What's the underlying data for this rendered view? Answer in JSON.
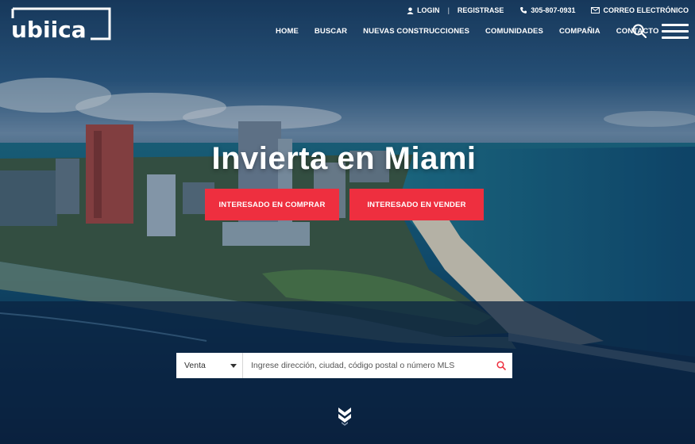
{
  "brand": {
    "logo_text": "ubiica"
  },
  "topbar": {
    "login_label": "LOGIN",
    "register_label": "REGISTRASE",
    "phone": "305-807-0931",
    "email_label": "CORREO ELECTRÓNICO"
  },
  "nav": {
    "items": [
      {
        "label": "HOME"
      },
      {
        "label": "BUSCAR"
      },
      {
        "label": "NUEVAS CONSTRUCCIONES"
      },
      {
        "label": "COMUNIDADES"
      },
      {
        "label": "COMPAÑIA"
      },
      {
        "label": "CONTACTO"
      }
    ]
  },
  "hero": {
    "title": "Invierta en Miami",
    "buy_label": "INTERESADO EN COMPRAR",
    "sell_label": "INTERESADO EN VENDER"
  },
  "search": {
    "type_selected": "Venta",
    "placeholder": "Ingrese dirección, ciudad, código postal o número MLS"
  },
  "colors": {
    "accent": "#ee2f3f",
    "text_light": "#ffffff"
  },
  "icons": [
    "user-icon",
    "phone-icon",
    "envelope-icon",
    "search-icon",
    "hamburger-menu-icon",
    "chevron-double-down-icon"
  ]
}
